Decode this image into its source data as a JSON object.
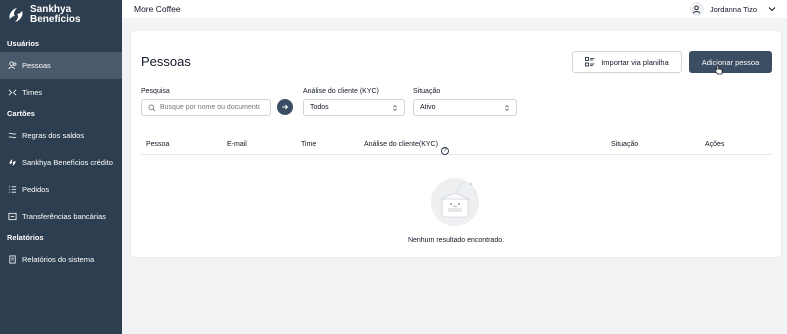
{
  "brand": {
    "line1": "Sankhya",
    "line2": "Benefícios"
  },
  "sidebar": {
    "sections": [
      {
        "title": "Usuários",
        "items": [
          {
            "label": "Pessoas",
            "icon": "users-icon",
            "active": true
          },
          {
            "label": "Times",
            "icon": "team-icon",
            "active": false
          }
        ]
      },
      {
        "title": "Cartões",
        "items": [
          {
            "label": "Regras dos saldos",
            "icon": "rules-icon",
            "active": false
          },
          {
            "label": "Sankhya Benefícios crédito",
            "icon": "credit-icon",
            "active": false
          },
          {
            "label": "Pedidos",
            "icon": "list-icon",
            "active": false
          },
          {
            "label": "Transferências bancárias",
            "icon": "transfer-icon",
            "active": false
          }
        ]
      },
      {
        "title": "Relatórios",
        "items": [
          {
            "label": "Relatórios do sistema",
            "icon": "report-icon",
            "active": false
          }
        ]
      }
    ]
  },
  "topbar": {
    "company": "More Coffee",
    "user": "Jordanna Tizo"
  },
  "main": {
    "title": "Pessoas",
    "import_label": "Importar via planilha",
    "add_label": "Adicionar pessoa",
    "filters": {
      "search_label": "Pesquisa",
      "search_placeholder": "Busque por nome ou documento",
      "kyc_label": "Análise do cliente (KYC)",
      "kyc_value": "Todos",
      "status_label": "Situação",
      "status_value": "Ativo"
    },
    "columns": [
      "Pessoa",
      "E-mail",
      "Time",
      "Análise do cliente(KYC)",
      "Situação",
      "Ações"
    ],
    "empty_text": "Nenhum resultado encontrado."
  },
  "colors": {
    "sidebar": "#2d3e50",
    "sidebar_active": "#4a5a6c",
    "primary_button": "#3a4d63"
  }
}
